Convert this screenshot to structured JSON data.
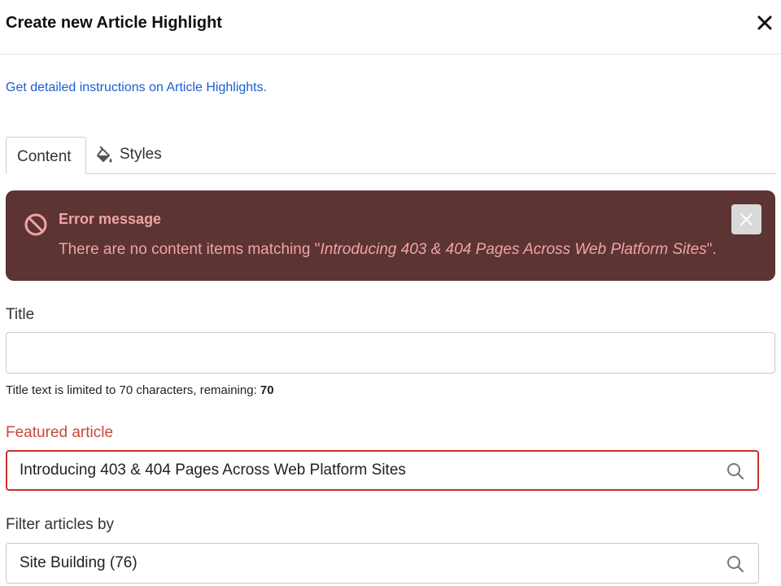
{
  "dialog": {
    "title": "Create new Article Highlight",
    "close_icon": "close-icon"
  },
  "help_link": "Get detailed instructions on Article Highlights.",
  "tabs": [
    {
      "label": "Content",
      "active": true
    },
    {
      "label": "Styles",
      "icon": "paint-bucket-icon",
      "active": false
    }
  ],
  "error": {
    "heading": "Error message",
    "text_prefix": "There are no content items matching \"",
    "text_query": "Introducing 403 & 404 Pages Across Web Platform Sites",
    "text_suffix": "\".",
    "icon": "prohibited-icon",
    "dismiss_icon": "close-icon",
    "background": "#5b3433",
    "text_color": "#f1a3a6"
  },
  "title_field": {
    "label": "Title",
    "value": "",
    "hint_prefix": "Title text is limited to 70 characters, remaining: ",
    "hint_remaining": "70"
  },
  "featured_field": {
    "label": "Featured article",
    "value": "Introducing 403 & 404 Pages Across Web Platform Sites",
    "icon": "search-icon",
    "error_color": "#c9302c"
  },
  "filter_field": {
    "label": "Filter articles by",
    "value": "Site Building (76)",
    "icon": "search-icon"
  },
  "colors": {
    "link": "#1a5fd0",
    "label_error": "#c9473f"
  }
}
